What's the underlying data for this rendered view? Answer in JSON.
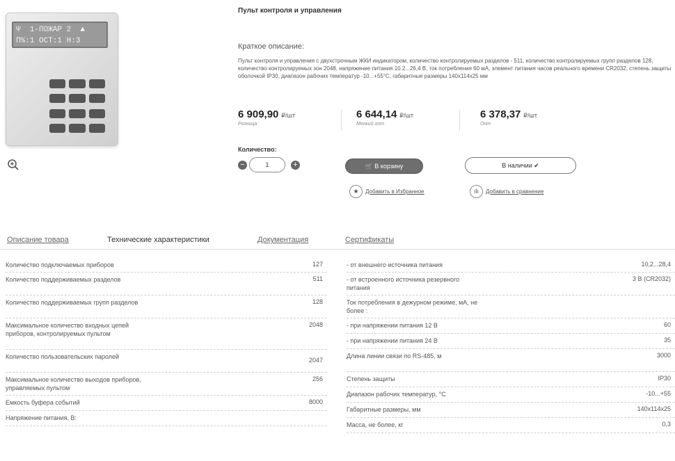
{
  "product": {
    "title": "Пульт контроля и управления",
    "lcd_line1": "Ψ  1-ПОЖАР 2  ▲",
    "lcd_line2": "П%:1 ОСТ:1 Н:3 "
  },
  "description": {
    "heading": "Краткое описание:",
    "text": "Пульт контроля и управления с двухстрочным ЖКИ индикатором, количество контролируемых разделов - 511, количество контролируемых групп разделов 128, количество контролируемых зон 2048, напряжение питания 10.2...26,4 В, ток потребления 60 мА, элемент питания часов реального времени CR2032, степень защиты оболочкой IP30, диапазон рабочих температур -10...+55°C, габаритные размеры 140х114х25 мм"
  },
  "prices": [
    {
      "amount": "6 909,90",
      "unit": "₽/шт",
      "label": "Розница"
    },
    {
      "amount": "6 644,14",
      "unit": "₽/шт",
      "label": "Мелкий опт"
    },
    {
      "amount": "6 378,37",
      "unit": "₽/шт",
      "label": "Опт"
    }
  ],
  "quantity": {
    "label": "Количество:",
    "value": "1"
  },
  "actions": {
    "cart_label": "🛒 В корзину",
    "stock_label": "В наличии ✔",
    "favorite_label": "Добавить в Избранное",
    "compare_label": "Добавить в сравнение"
  },
  "tabs": [
    {
      "label": "Описание товара"
    },
    {
      "label": "Технические характеристики"
    },
    {
      "label": "Документация"
    },
    {
      "label": "Сертификаты"
    }
  ],
  "specs_left": [
    {
      "k": "Количество подключаемых приборов",
      "v": "127"
    },
    {
      "k": "Количество поддерживаемых разделов",
      "v": "511"
    },
    {
      "k": "Количество поддерживаемых групп разделов",
      "v": "128"
    },
    {
      "k": "Максимальное количество входных цепей приборов, контролируемых пультом",
      "v": "2048"
    },
    {
      "k": "Количество пользовательских паролей",
      "v": "2047"
    },
    {
      "k": "Максимальное количество выходов приборов, управляемых пультом",
      "v": "256"
    },
    {
      "k": "Емкость буфера событий",
      "v": "8000"
    },
    {
      "k": "Напряжение питания, В:",
      "v": ""
    }
  ],
  "specs_right": [
    {
      "k": "- от внешнего источника питания",
      "v": "10,2...28,4"
    },
    {
      "k": "- от встроенного источника резервного питания",
      "v": "3 В (CR2032)"
    },
    {
      "k": "Ток потребления в дежурном режиме, мА, не более :",
      "v": ""
    },
    {
      "k": "- при напряжении питания 12 В",
      "v": "60"
    },
    {
      "k": "- при напряжении питания 24 В",
      "v": "35"
    },
    {
      "k": "Длина линии связи по RS-485, м",
      "v": "3000"
    },
    {
      "k": "Степень защиты",
      "v": "IP30"
    },
    {
      "k": "Диапазон рабочих температур, °С",
      "v": "-10...+55"
    },
    {
      "k": "Габаритные размеры, мм",
      "v": "140х114х25"
    },
    {
      "k": "Масса, не более, кг",
      "v": "0,3"
    }
  ]
}
